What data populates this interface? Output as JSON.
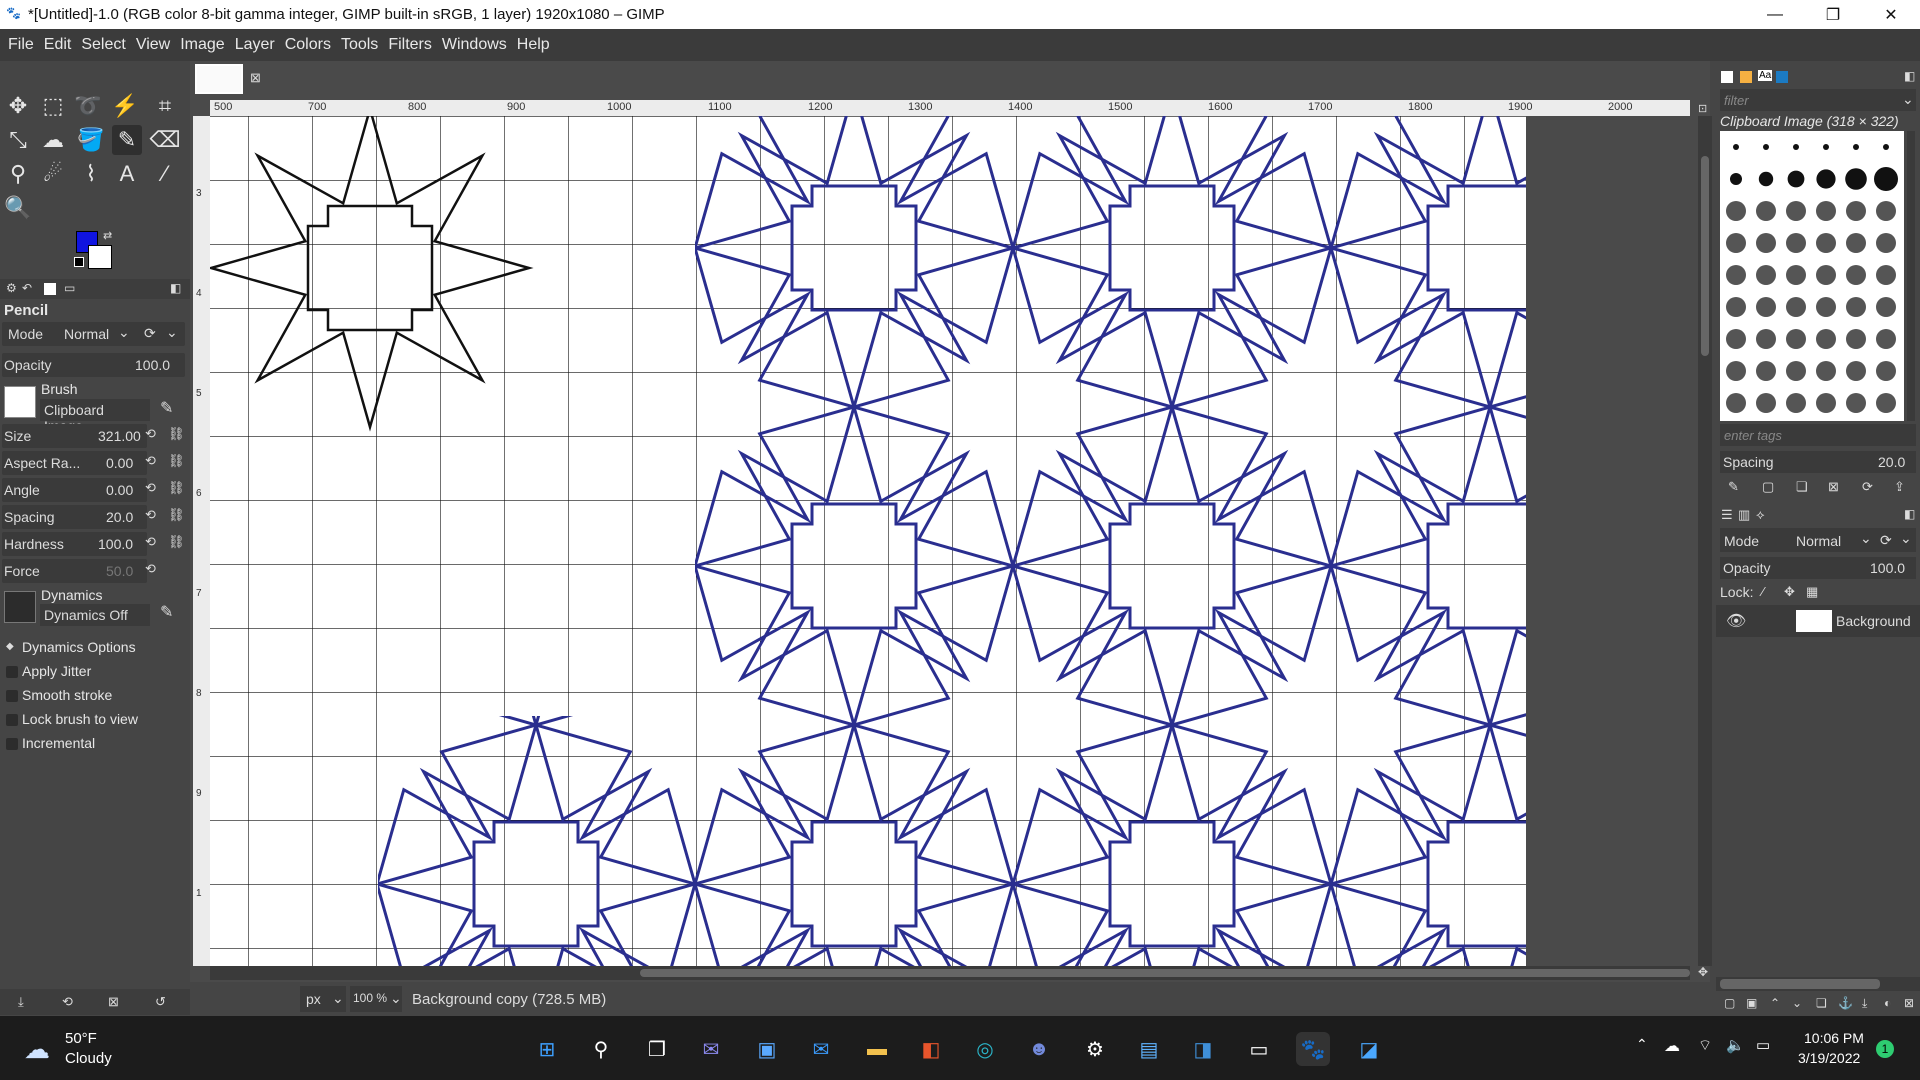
{
  "titlebar": {
    "title": "*[Untitled]-1.0 (RGB color 8-bit gamma integer, GIMP built-in sRGB, 1 layer) 1920x1080 – GIMP",
    "minimize_icon": "minimize-icon",
    "maximize_icon": "restore-icon",
    "close_icon": "close-icon"
  },
  "menu": [
    "File",
    "Edit",
    "Select",
    "View",
    "Image",
    "Layer",
    "Colors",
    "Tools",
    "Filters",
    "Windows",
    "Help"
  ],
  "tool_options": {
    "tool_name": "Pencil",
    "mode_label": "Mode",
    "mode_value": "Normal",
    "opacity_label": "Opacity",
    "opacity_value": "100.0",
    "brush_label": "Brush",
    "brush_value": "Clipboard Image",
    "size_label": "Size",
    "size_value": "321.00",
    "aspect_label": "Aspect Ra...",
    "aspect_value": "0.00",
    "angle_label": "Angle",
    "angle_value": "0.00",
    "spacing_label": "Spacing",
    "spacing_value": "20.0",
    "hardness_label": "Hardness",
    "hardness_value": "100.0",
    "force_label": "Force",
    "force_value": "50.0",
    "dynamics_label": "Dynamics",
    "dynamics_value": "Dynamics Off",
    "checkbox_labels": [
      "Dynamics Options",
      "Apply Jitter",
      "Smooth stroke",
      "Lock brush to view",
      "Incremental"
    ]
  },
  "rulers": {
    "top": [
      "500",
      "700",
      "800",
      "900",
      "1000",
      "1100",
      "1200",
      "1300",
      "1400",
      "1500",
      "1600",
      "1700",
      "1800",
      "1900",
      "2000"
    ],
    "left": [
      "3",
      "4",
      "5",
      "6",
      "7",
      "8",
      "9",
      "1"
    ]
  },
  "status": {
    "unit": "px",
    "zoom": "100 %",
    "info": "Background copy (728.5 MB)"
  },
  "brushes_panel": {
    "filter_placeholder": "filter",
    "brush_name": "Clipboard Image (318 × 322)",
    "tags_placeholder": "enter tags",
    "spacing_label": "Spacing",
    "spacing_value": "20.0"
  },
  "layers_panel": {
    "mode_label": "Mode",
    "mode_value": "Normal",
    "opacity_label": "Opacity",
    "opacity_value": "100.0",
    "lock_label": "Lock:",
    "layer_name": "Background"
  },
  "taskbar": {
    "weather_temp": "50°F",
    "weather_desc": "Cloudy",
    "time": "10:06 PM",
    "date": "3/19/2022",
    "notification_count": "1"
  },
  "colors": {
    "fg": "#1014e0",
    "bg": "#ffffff",
    "pattern": "#2a2e8f"
  }
}
